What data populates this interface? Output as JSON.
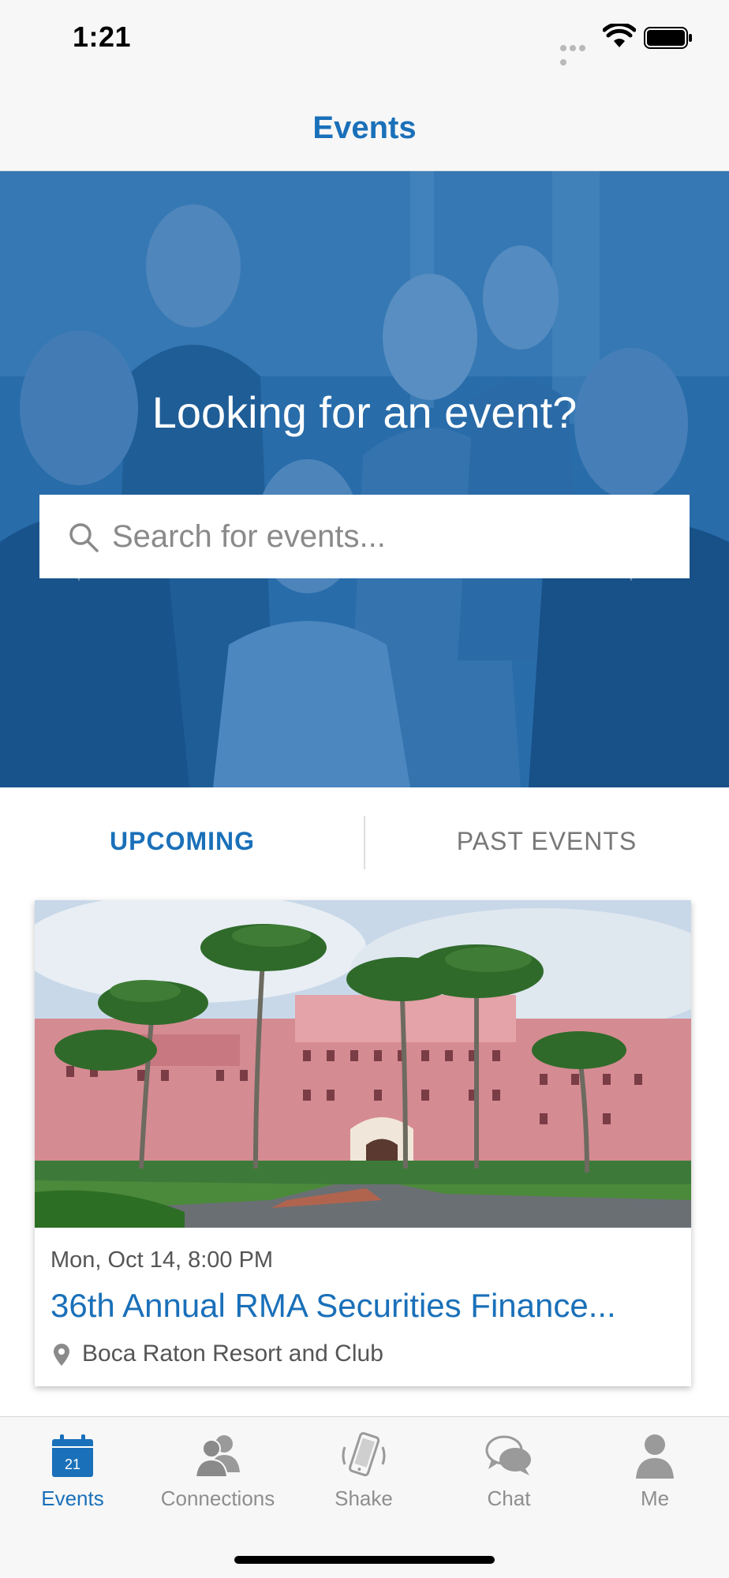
{
  "status_bar": {
    "time": "1:21"
  },
  "nav": {
    "title": "Events"
  },
  "hero": {
    "heading": "Looking for an event?",
    "search_placeholder": "Search for events..."
  },
  "tabs": [
    {
      "label": "UPCOMING",
      "active": true
    },
    {
      "label": "PAST EVENTS",
      "active": false
    }
  ],
  "events": [
    {
      "date": "Mon, Oct 14, 8:00 PM",
      "title": "36th Annual RMA Securities Finance...",
      "location": "Boca Raton Resort and Club"
    }
  ],
  "tab_bar": {
    "calendar_day": "21",
    "items": [
      {
        "label": "Events",
        "icon": "calendar-icon",
        "active": true
      },
      {
        "label": "Connections",
        "icon": "connections-icon",
        "active": false
      },
      {
        "label": "Shake",
        "icon": "shake-phone-icon",
        "active": false
      },
      {
        "label": "Chat",
        "icon": "chat-bubbles-icon",
        "active": false
      },
      {
        "label": "Me",
        "icon": "person-icon",
        "active": false
      }
    ]
  },
  "colors": {
    "accent": "#1a70b9",
    "hero_overlay": "#2b6fab",
    "inactive": "#8e8e8e"
  }
}
